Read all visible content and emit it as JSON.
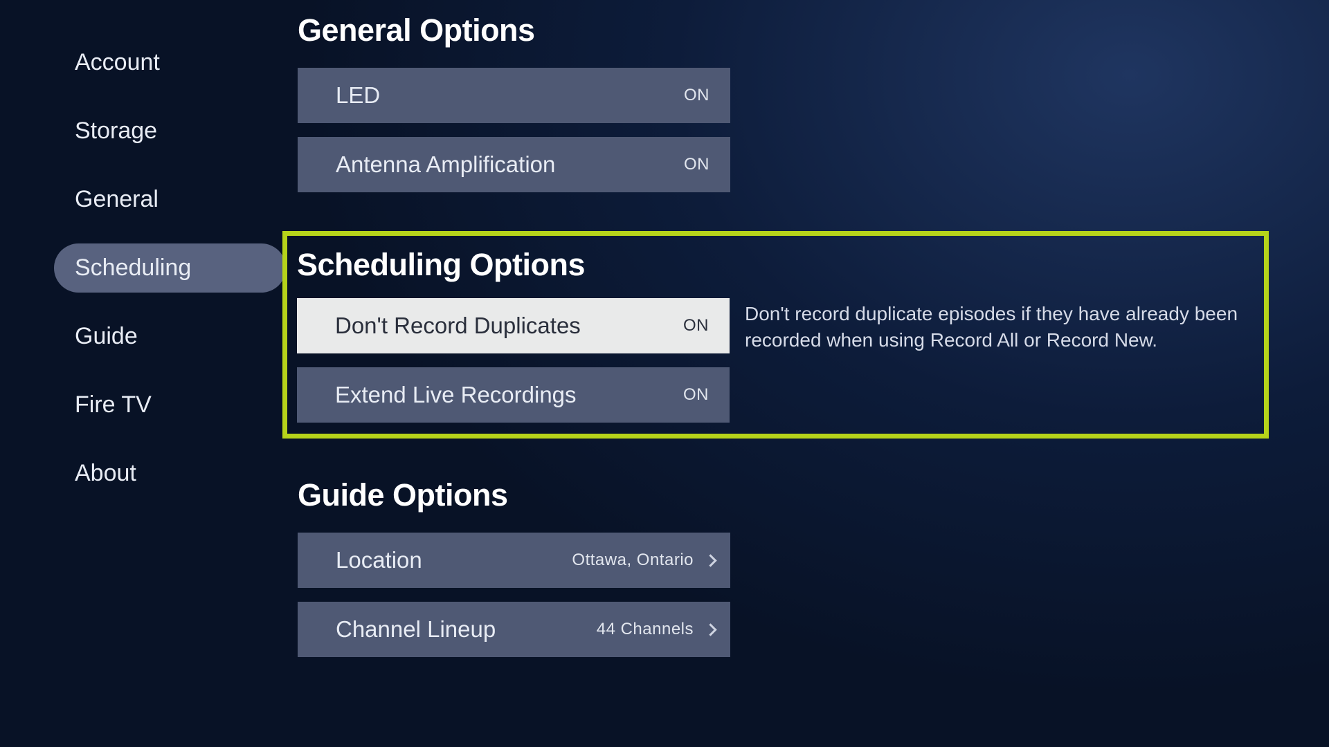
{
  "sidebar": {
    "items": [
      {
        "label": "Account",
        "active": false
      },
      {
        "label": "Storage",
        "active": false
      },
      {
        "label": "General",
        "active": false
      },
      {
        "label": "Scheduling",
        "active": true
      },
      {
        "label": "Guide",
        "active": false
      },
      {
        "label": "Fire TV",
        "active": false
      },
      {
        "label": "About",
        "active": false
      }
    ]
  },
  "general": {
    "title": "General Options",
    "led_label": "LED",
    "led_value": "ON",
    "antenna_label": "Antenna Amplification",
    "antenna_value": "ON"
  },
  "scheduling": {
    "title": "Scheduling Options",
    "duplicates_label": "Don't Record Duplicates",
    "duplicates_value": "ON",
    "description": "Don't record duplicate episodes if they have already been recorded when using Record All or Record New.",
    "extend_label": "Extend Live Recordings",
    "extend_value": "ON"
  },
  "guide": {
    "title": "Guide Options",
    "location_label": "Location",
    "location_value": "Ottawa, Ontario",
    "lineup_label": "Channel Lineup",
    "lineup_value": "44 Channels"
  }
}
